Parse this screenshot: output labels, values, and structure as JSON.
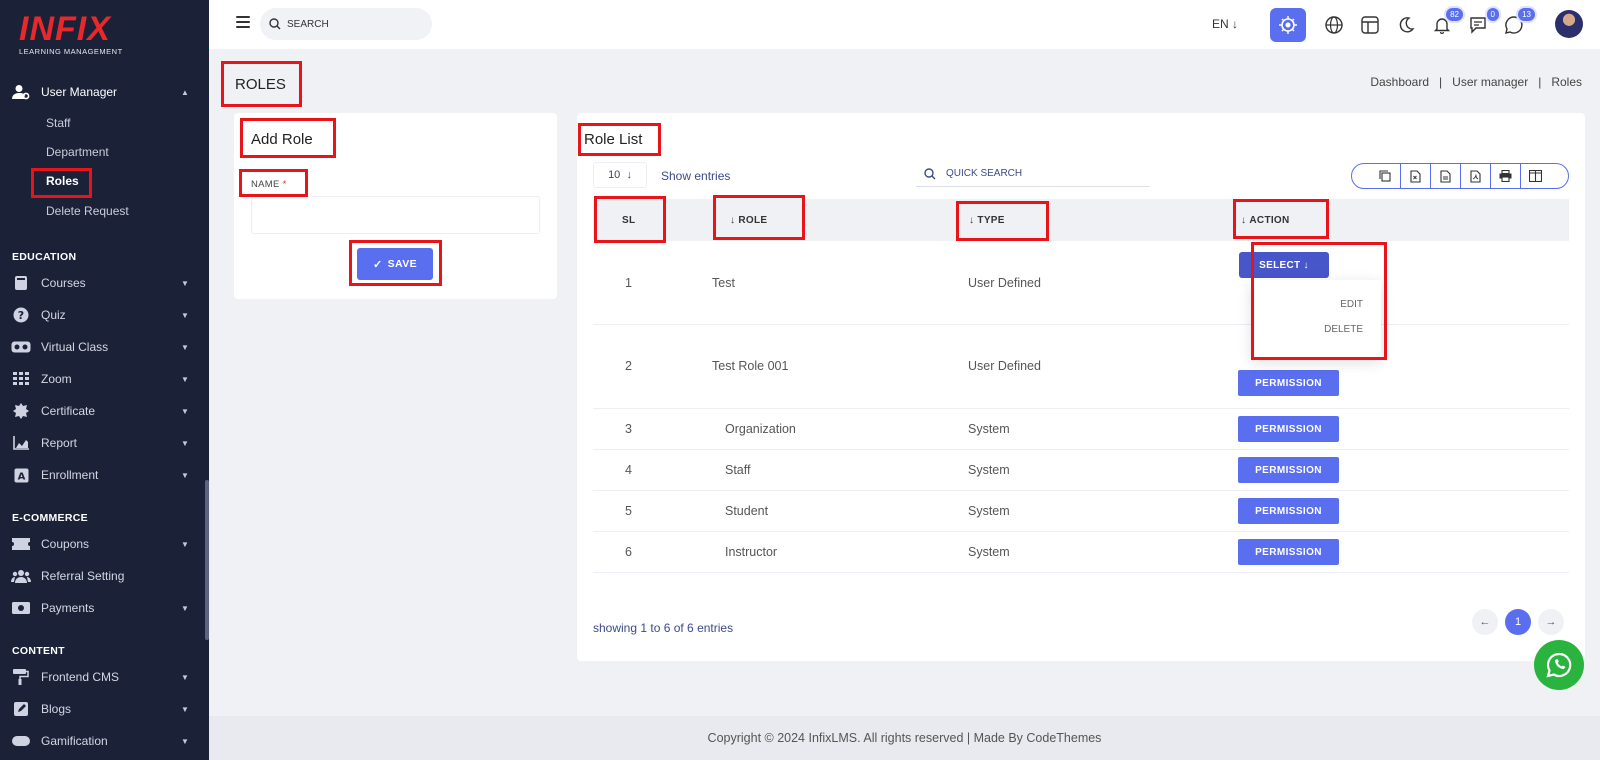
{
  "brand": {
    "name": "INFIX",
    "tagline": "LEARNING MANAGEMENT"
  },
  "sidebar": {
    "user_manager": {
      "label": "User Manager",
      "items": [
        "Staff",
        "Department",
        "Roles",
        "Delete Request"
      ]
    },
    "sections": [
      {
        "heading": "EDUCATION",
        "items": [
          "Courses",
          "Quiz",
          "Virtual Class",
          "Zoom",
          "Certificate",
          "Report",
          "Enrollment"
        ]
      },
      {
        "heading": "E-COMMERCE",
        "items": [
          "Coupons",
          "Referral Setting",
          "Payments"
        ]
      },
      {
        "heading": "CONTENT",
        "items": [
          "Frontend CMS",
          "Blogs",
          "Gamification"
        ]
      }
    ]
  },
  "topbar": {
    "search_placeholder": "SEARCH",
    "language": "EN",
    "notifications_count": "82",
    "messages_count": "0",
    "chat_count": "13"
  },
  "page": {
    "title": "ROLES",
    "breadcrumb": [
      "Dashboard",
      "User manager",
      "Roles"
    ]
  },
  "add_role": {
    "title": "Add Role",
    "name_label": "NAME",
    "required_mark": "*",
    "save_label": "SAVE"
  },
  "role_list": {
    "title": "Role List",
    "entries_value": "10",
    "entries_label": "Show entries",
    "search_placeholder": "QUICK SEARCH",
    "columns": [
      "SL",
      "ROLE",
      "TYPE",
      "ACTION"
    ],
    "rows": [
      {
        "sl": "1",
        "role": "Test",
        "type": "User Defined",
        "action": "SELECT"
      },
      {
        "sl": "2",
        "role": "Test Role 001",
        "type": "User Defined",
        "action": "PERMISSION"
      },
      {
        "sl": "3",
        "role": "Organization",
        "type": "System",
        "action": "PERMISSION"
      },
      {
        "sl": "4",
        "role": "Staff",
        "type": "System",
        "action": "PERMISSION"
      },
      {
        "sl": "5",
        "role": "Student",
        "type": "System",
        "action": "PERMISSION"
      },
      {
        "sl": "6",
        "role": "Instructor",
        "type": "System",
        "action": "PERMISSION"
      }
    ],
    "dropdown_items": [
      "EDIT",
      "DELETE"
    ],
    "showing": "showing 1 to 6 of 6 entries",
    "current_page": "1"
  },
  "footer": {
    "text": "Copyright © 2024 InfixLMS. All rights reserved | Made By CodeThemes"
  },
  "colors": {
    "sidebar_bg": "#1b2238",
    "primary": "#5a6ff0",
    "highlight": "#e8141a",
    "whatsapp": "#2ab33e"
  }
}
